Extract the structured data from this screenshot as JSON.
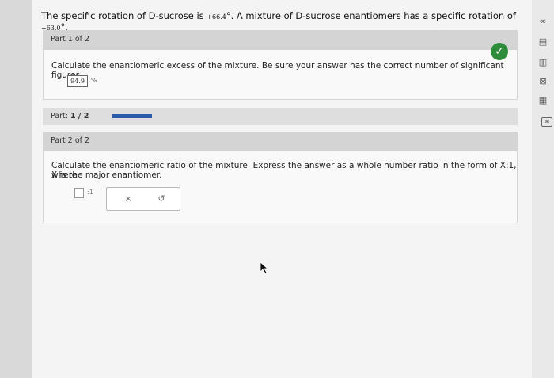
{
  "question": {
    "prefix": "The specific rotation of D-sucrose is ",
    "rotation_pure": "+66.4",
    "middle": "°. A mixture of D-sucrose enantiomers has a specific rotation of ",
    "rotation_mixture": "+63.0",
    "suffix": "°."
  },
  "part1": {
    "header": "Part 1 of 2",
    "instruction": "Calculate the enantiomeric excess of the mixture. Be sure your answer has the correct number of significant figures.",
    "answer_value": "94.9",
    "answer_unit": "%",
    "status_icon": "check-icon"
  },
  "progress": {
    "label": "Part:",
    "value_text": "1 / 2",
    "fraction": 0.5
  },
  "part2": {
    "header": "Part 2 of 2",
    "instruction_line1": "Calculate the enantiomeric ratio of the mixture. Express the answer as a whole number ratio in the form of X:1, where",
    "instruction_line2": "X is the major enantiomer.",
    "ratio_suffix": ":1",
    "tools": {
      "clear": "×",
      "undo": "↺"
    }
  },
  "side_toolbar": {
    "icons": [
      "infinity-icon",
      "document-icon",
      "bar-chart-icon",
      "equation-icon",
      "periodic-table-icon",
      "message-icon"
    ]
  },
  "colors": {
    "check_green": "#2e8b3a",
    "progress_blue": "#2b5aa8"
  }
}
